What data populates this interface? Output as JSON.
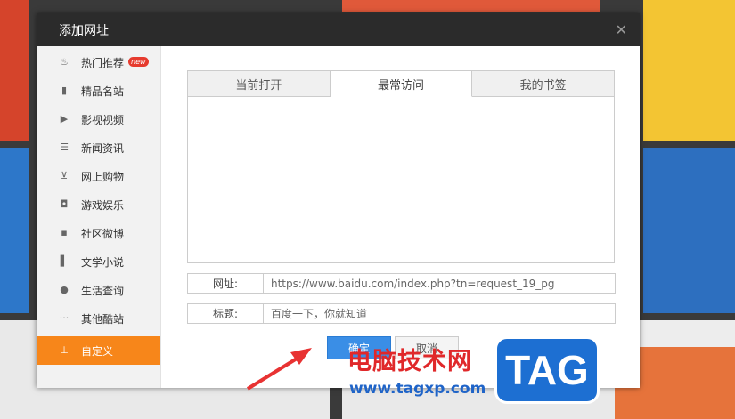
{
  "dialog": {
    "title": "添加网址",
    "close_icon": "close-icon"
  },
  "sidebar": {
    "items": [
      {
        "label": "热门推荐",
        "icon": "fire-icon",
        "badge": "new"
      },
      {
        "label": "精品名站",
        "icon": "bookmark-icon"
      },
      {
        "label": "影视视频",
        "icon": "play-icon"
      },
      {
        "label": "新闻资讯",
        "icon": "news-icon"
      },
      {
        "label": "网上购物",
        "icon": "cart-icon"
      },
      {
        "label": "游戏娱乐",
        "icon": "gamepad-icon"
      },
      {
        "label": "社区微博",
        "icon": "chat-icon"
      },
      {
        "label": "文学小说",
        "icon": "book-icon"
      },
      {
        "label": "生活查询",
        "icon": "user-icon"
      },
      {
        "label": "其他酷站",
        "icon": "more-icon"
      },
      {
        "label": "自定义",
        "icon": "custom-icon",
        "active": true
      }
    ]
  },
  "tabs": [
    {
      "label": "当前打开"
    },
    {
      "label": "最常访问",
      "active": true
    },
    {
      "label": "我的书签"
    }
  ],
  "form": {
    "url_label": "网址:",
    "url_value": "https://www.baidu.com/index.php?tn=request_19_pg",
    "title_label": "标题:",
    "title_value": "百度一下，你就知道"
  },
  "buttons": {
    "ok": "确定",
    "cancel": "取消"
  },
  "watermark": {
    "text": "电脑技术网",
    "url": "www.tagxp.com",
    "logo": "TAG"
  },
  "colors": {
    "active_item": "#f7861a",
    "titlebar": "#2b2b2b",
    "ok_button": "#3a8ee6"
  }
}
